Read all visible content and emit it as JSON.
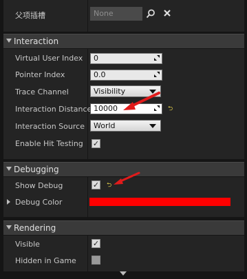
{
  "top": {
    "label": "父项插槽",
    "parent_socket_value": "None"
  },
  "interaction": {
    "title": "Interaction",
    "virtual_user_index": {
      "label": "Virtual User Index",
      "value": "0"
    },
    "pointer_index": {
      "label": "Pointer Index",
      "value": "0.0"
    },
    "trace_channel": {
      "label": "Trace Channel",
      "value": "Visibility"
    },
    "interaction_distance": {
      "label": "Interaction Distance",
      "value": "10000"
    },
    "interaction_source": {
      "label": "Interaction Source",
      "value": "World"
    },
    "enable_hit_testing": {
      "label": "Enable Hit Testing",
      "checked": true
    }
  },
  "debugging": {
    "title": "Debugging",
    "show_debug": {
      "label": "Show Debug",
      "checked": true
    },
    "debug_color": {
      "label": "Debug Color",
      "color": "#ff0000"
    }
  },
  "rendering": {
    "title": "Rendering",
    "visible": {
      "label": "Visible",
      "checked": true
    },
    "hidden_in_game": {
      "label": "Hidden in Game",
      "checked": false
    }
  },
  "colors": {
    "annotation_arrow": "#e11b1b",
    "reset_arrow": "#e6d24c"
  }
}
